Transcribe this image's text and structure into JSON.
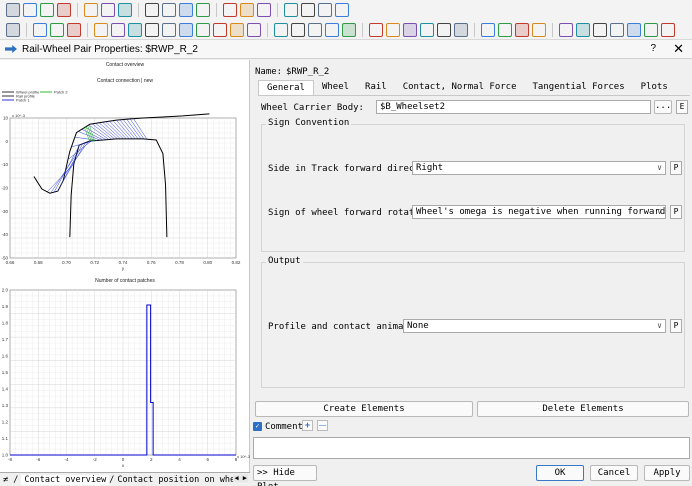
{
  "toolbar": {
    "row1_icons": [
      "new-document-icon",
      "open-folder-icon",
      "save-icon",
      "save-as-icon",
      "copy-icon",
      "paste-icon",
      "calendar-icon",
      "model-icon",
      "undo-icon",
      "undo-dropdown-icon",
      "redo-icon",
      "window-icon",
      "windows-icon",
      "window-group-icon",
      "link-icon",
      "model-tree-icon",
      "graph-icon",
      "graph-tree-icon"
    ],
    "row2_icons": [
      "settings-icon",
      "tools-icon",
      "tools-x-icon",
      "body-icon",
      "joint-icon",
      "marker-icon",
      "frame-icon",
      "sensor-icon",
      "arrow-icon",
      "force-icon",
      "triangle-icon",
      "spring-icon",
      "gear-icon",
      "chart-icon",
      "road-icon",
      "s-function-icon",
      "m-function-icon",
      "f-function-icon",
      "text-icon",
      "car-icon",
      "grid-icon",
      "triangle-pattern-icon",
      "slashes-icon",
      "feather-icon",
      "ibeam-icon",
      "filter-icon",
      "arrows-icon",
      "filter-2-icon",
      "link-2-icon",
      "bookmark-icon",
      "wave-icon",
      "u-function-icon",
      "u-arrow-icon",
      "y-arrow-icon",
      "arrow-up-icon",
      "shape-icon"
    ],
    "text_icons": {
      "s_fn": "S(x)",
      "m_fn": "M(x)",
      "f_fn": "f(x)",
      "text": "Text",
      "u": "u",
      "y": "y"
    }
  },
  "window": {
    "title": "Rail-Wheel Pair Properties: $RWP_R_2",
    "help": "?",
    "close": "✕"
  },
  "plot_panel": {
    "plot1": {
      "heading": "Contact overview",
      "subtitle": "Contact connection | new",
      "legend": [
        "Wheel profile",
        "Rail profile",
        "Patch 1",
        "Patch 2"
      ],
      "exponent": "x 10^-3",
      "y_ticks": [
        "10",
        "0",
        "-10",
        "-20",
        "-30",
        "-40",
        "-50"
      ],
      "x_ticks": [
        "0.66",
        "0.68",
        "0.70",
        "0.72",
        "0.74",
        "0.76",
        "0.78",
        "0.80",
        "0.82"
      ],
      "xlabel": "y",
      "ylabel": "z"
    },
    "plot2": {
      "heading": "Number of contact patches",
      "y_ticks": [
        "2.0",
        "1.9",
        "1.8",
        "1.7",
        "1.6",
        "1.5",
        "1.4",
        "1.3",
        "1.2",
        "1.1",
        "1.0"
      ],
      "x_ticks": [
        "-8",
        "-6",
        "-4",
        "-2",
        "0",
        "2",
        "4",
        "6",
        "8"
      ],
      "exponent": "x 10^-3",
      "xlabel": "x",
      "ylabel": "N"
    },
    "sheet_tabs": [
      "Contact overview",
      "Contact position on wheel"
    ],
    "sheet_nav": "◀ ▶"
  },
  "chart_data": [
    {
      "type": "line",
      "title": "Contact overview",
      "subtitle": "Contact connection | new",
      "xlabel": "y",
      "ylabel": "z",
      "series": [
        {
          "name": "Wheel profile",
          "color": "#000000",
          "x": [
            0.678,
            0.684,
            0.69,
            0.696,
            0.7,
            0.705,
            0.71,
            0.72,
            0.73,
            0.74,
            0.75,
            0.76,
            0.775,
            0.79,
            0.81
          ],
          "y": [
            -16,
            -22,
            -24,
            -23,
            -18,
            -4,
            5,
            9,
            10,
            11,
            11.5,
            12,
            12.5,
            13,
            14
          ]
        },
        {
          "name": "Rail profile",
          "color": "#000000",
          "x": [
            0.705,
            0.706,
            0.708,
            0.712,
            0.72,
            0.73,
            0.74,
            0.75,
            0.76,
            0.77,
            0.775,
            0.777,
            0.778
          ],
          "y": [
            -45,
            -25,
            -10,
            -1,
            1,
            1.5,
            2,
            2,
            2,
            1.5,
            -5,
            -20,
            -45
          ]
        },
        {
          "name": "Patch 1",
          "color": "#0000cc"
        },
        {
          "name": "Patch 2",
          "color": "#00aa00"
        }
      ],
      "xlim": [
        0.66,
        0.83
      ],
      "ylim": [
        -55,
        12
      ],
      "y_scale_label": "x 10^-3",
      "grid": true,
      "legend": "top-left"
    },
    {
      "type": "line",
      "title": "Number of contact patches",
      "xlabel": "x",
      "ylabel": "N",
      "series": [
        {
          "name": "contact patches",
          "color": "#0000cc",
          "x": [
            -9,
            1.8,
            1.9,
            1.9,
            2.2,
            2.2,
            2.4,
            2.4,
            9
          ],
          "y": [
            1,
            1,
            1,
            2,
            2,
            1.35,
            1.35,
            1,
            1
          ]
        }
      ],
      "xlim": [
        -9,
        9
      ],
      "ylim": [
        1.0,
        2.1
      ],
      "x_scale_label": "x 10^-3",
      "grid": true
    }
  ],
  "form": {
    "name_label": "Name:",
    "name_value": "$RWP_R_2",
    "tabs": [
      "General",
      "Wheel",
      "Rail",
      "Contact, Normal Force",
      "Tangential Forces",
      "Plots"
    ],
    "active_tab": "General",
    "carrier_label": "Wheel Carrier Body:",
    "carrier_value": "$B_Wheelset2",
    "browse_label": "...",
    "e_label": "E",
    "sign_group": "Sign Convention",
    "side_label": "Side in Track forward direction:",
    "side_value": "Right",
    "rotation_label": "Sign of wheel forward rotation:",
    "rotation_value": "Wheel's omega is negative when running forward",
    "p_label": "P",
    "output_group": "Output",
    "anim_label": "Profile and contact animation:",
    "anim_value": "None",
    "create_button": "Create Elements",
    "delete_button": "Delete Elements",
    "comment_label": "Comment",
    "comment_add": "+",
    "comment_remove": "—",
    "hide_plot_button": ">> Hide Plot",
    "ok_button": "OK",
    "cancel_button": "Cancel",
    "apply_button": "Apply"
  }
}
